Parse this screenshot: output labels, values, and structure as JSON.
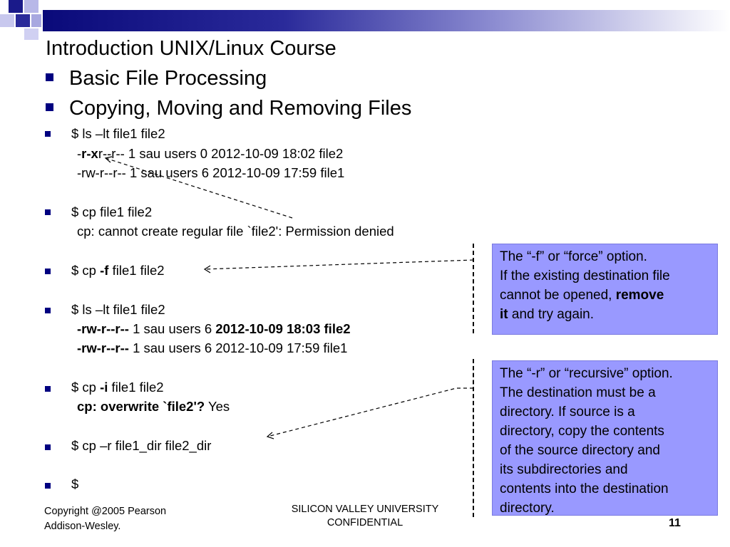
{
  "title": "Introduction UNIX/Linux Course",
  "bullets": [
    "Basic File Processing",
    "Copying, Moving and Removing Files"
  ],
  "ls1": {
    "cmd": "$ ls –lt file1 file2",
    "r1_pre": "-",
    "r1_bold": "r-x",
    "r1_rest": "r--r-- 1 sau users   0 2012-10-09 18:02 file2",
    "r2": "-rw-r--r-- 1 sau users   6 2012-10-09 17:59 file1"
  },
  "cp1": {
    "cmd": "$ cp file1 file2",
    "err": "cp: cannot create regular file `file2': Permission denied"
  },
  "cpf": {
    "pre": "$ cp ",
    "flag": "-f",
    "post": " file1 file2"
  },
  "ls2": {
    "cmd": "$ ls –lt file1 file2",
    "r1_perm": "-rw-r--r--",
    "r1_mid": " 1 sau users   6 ",
    "r1_date": "2012-10-09 18:03 file2",
    "r2_perm": "-rw-r--r--",
    "r2_rest": " 1 sau users   6 2012-10-09 17:59 file1"
  },
  "cpi": {
    "pre": "$ cp ",
    "flag": "-i",
    "post": " file1 file2",
    "prompt": "cp: overwrite `file2'?",
    "answer": " Yes"
  },
  "cpr": {
    "cmd": "$ cp –r  file1_dir  file2_dir"
  },
  "last": {
    "cmd": "$"
  },
  "callout_f": {
    "l1": "The “-f” or “force” option.",
    "l2": "If the existing destination file",
    "l3": "cannot be opened, ",
    "l3_bold": "remove",
    "l4_bold": "it",
    "l4": " and try again."
  },
  "callout_r": {
    "lines": [
      "The “-r” or “recursive” option.",
      "The destination must be a",
      "directory. If source is a",
      "directory, copy the contents",
      "of the source directory and",
      "its subdirectories and",
      "contents into the destination",
      "directory."
    ]
  },
  "footer": {
    "copyright_1": "Copyright @2005 Pearson",
    "copyright_2": "Addison-Wesley.",
    "center_1": "SILICON VALLEY UNIVERSITY",
    "center_2": "CONFIDENTIAL",
    "page": "11"
  },
  "colors": {
    "bullet": "#000080",
    "callout": "#9999ff",
    "header_dark": "#0a0a7a"
  }
}
